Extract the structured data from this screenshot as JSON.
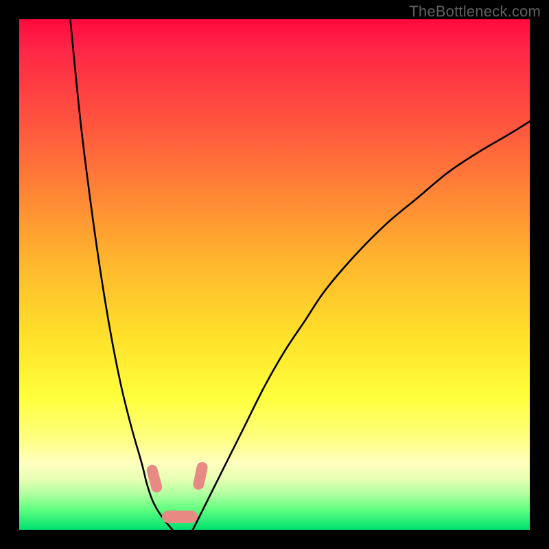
{
  "watermark": "TheBottleneck.com",
  "chart_data": {
    "type": "line",
    "title": "",
    "xlabel": "",
    "ylabel": "",
    "xlim": [
      0,
      100
    ],
    "ylim": [
      0,
      100
    ],
    "grid": false,
    "legend": false,
    "series": [
      {
        "name": "left-branch",
        "color": "#000000",
        "x": [
          10,
          12,
          14,
          16,
          18,
          20,
          22,
          24,
          25,
          26,
          27,
          28,
          29,
          30
        ],
        "y": [
          100,
          80,
          64,
          50,
          38,
          28,
          20,
          13,
          9,
          6,
          4,
          2.5,
          1.2,
          0
        ]
      },
      {
        "name": "right-branch",
        "color": "#000000",
        "x": [
          34,
          36,
          38,
          40,
          44,
          48,
          52,
          56,
          60,
          66,
          72,
          78,
          84,
          90,
          96,
          100
        ],
        "y": [
          0,
          4,
          8,
          12,
          20,
          28,
          35,
          41,
          47,
          54,
          60,
          65,
          70,
          74,
          77.5,
          80
        ]
      }
    ],
    "markers": [
      {
        "name": "marker-left-upper",
        "shape": "capsule",
        "x": 26.5,
        "y": 10,
        "w": 2.2,
        "h": 5.5,
        "angle": -15,
        "color": "#e78a84"
      },
      {
        "name": "marker-right-upper",
        "shape": "capsule",
        "x": 35.5,
        "y": 10.5,
        "w": 2.2,
        "h": 5.5,
        "angle": 12,
        "color": "#e78a84"
      },
      {
        "name": "marker-bottom",
        "shape": "capsule",
        "x": 31.5,
        "y": 2.5,
        "w": 7.0,
        "h": 2.4,
        "angle": 0,
        "color": "#e78a84"
      }
    ],
    "gradient_background": {
      "type": "vertical",
      "stops": [
        {
          "pos": 0.0,
          "color": "#ff0a3e"
        },
        {
          "pos": 0.36,
          "color": "#ff8c34"
        },
        {
          "pos": 0.74,
          "color": "#ffff3c"
        },
        {
          "pos": 1.0,
          "color": "#00e070"
        }
      ]
    }
  }
}
